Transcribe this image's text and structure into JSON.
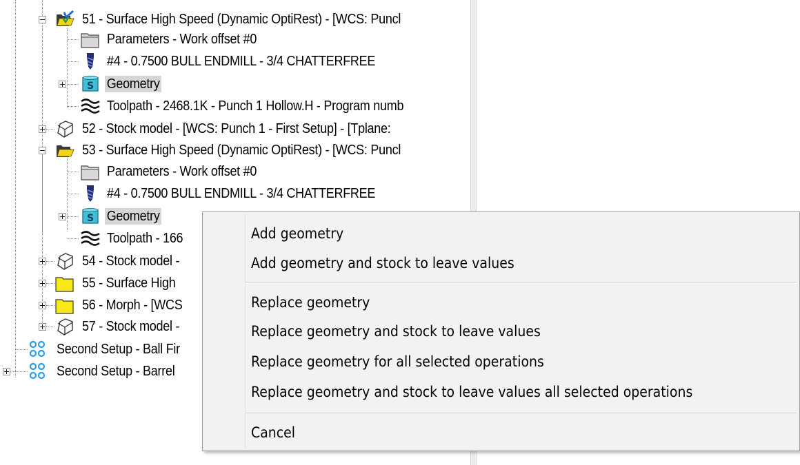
{
  "tree": {
    "items": [
      {
        "label": "51 - Surface High Speed (Dynamic OptiRest) - [WCS: Puncl",
        "icon": "open-folder-check-icon",
        "expander": "minus"
      },
      {
        "label": "Parameters - Work offset #0",
        "icon": "parameters-folder-icon"
      },
      {
        "label": "#4 - 0.7500 BULL ENDMILL - 3/4 CHATTERFREE",
        "icon": "endmill-tool-icon"
      },
      {
        "label": "Geometry",
        "icon": "geometry-s-icon",
        "expander": "plus",
        "selected": true
      },
      {
        "label": "Toolpath - 2468.1K - Punch 1 Hollow.H - Program numb",
        "icon": "toolpath-icon"
      },
      {
        "label": "52 - Stock model - [WCS: Punch 1 - First Setup] - [Tplane:",
        "icon": "stock-model-icon",
        "expander": "plus"
      },
      {
        "label": "53 - Surface High Speed (Dynamic OptiRest) - [WCS: Puncl",
        "icon": "open-folder-icon",
        "expander": "minus"
      },
      {
        "label": "Parameters - Work offset #0",
        "icon": "parameters-folder-icon"
      },
      {
        "label": "#4 - 0.7500 BULL ENDMILL - 3/4 CHATTERFREE",
        "icon": "endmill-tool-icon"
      },
      {
        "label": "Geometry",
        "icon": "geometry-s-icon",
        "expander": "plus",
        "selected": true
      },
      {
        "label": "Toolpath - 166",
        "icon": "toolpath-icon"
      },
      {
        "label": "54 - Stock model -",
        "icon": "stock-model-icon",
        "expander": "plus"
      },
      {
        "label": "55 - Surface High",
        "icon": "yellow-folder-icon",
        "expander": "plus"
      },
      {
        "label": "56 - Morph - [WCS",
        "icon": "yellow-folder-icon",
        "expander": "plus"
      },
      {
        "label": "57 - Stock model -",
        "icon": "stock-model-icon",
        "expander": "plus"
      },
      {
        "label": "Second Setup - Ball Fir",
        "icon": "machine-group-icon"
      },
      {
        "label": "Second Setup - Barrel",
        "icon": "machine-group-icon",
        "expander": "plus"
      }
    ]
  },
  "context_menu": {
    "items": [
      {
        "label": "Add geometry"
      },
      {
        "label": "Add geometry and stock to leave values"
      },
      {
        "label": "Replace geometry"
      },
      {
        "label": "Replace geometry and stock to leave values"
      },
      {
        "label": "Replace geometry for all selected operations"
      },
      {
        "label": "Replace geometry and stock to leave values all selected operations"
      },
      {
        "label": "Cancel"
      }
    ]
  },
  "colors": {
    "selection": "#d6d6d6",
    "menu_background": "#f2f2f2",
    "folder_yellow": "#f2dc14",
    "geometry_cyan": "#2bb3c9",
    "machine_group_blue": "#2a9ee8"
  }
}
